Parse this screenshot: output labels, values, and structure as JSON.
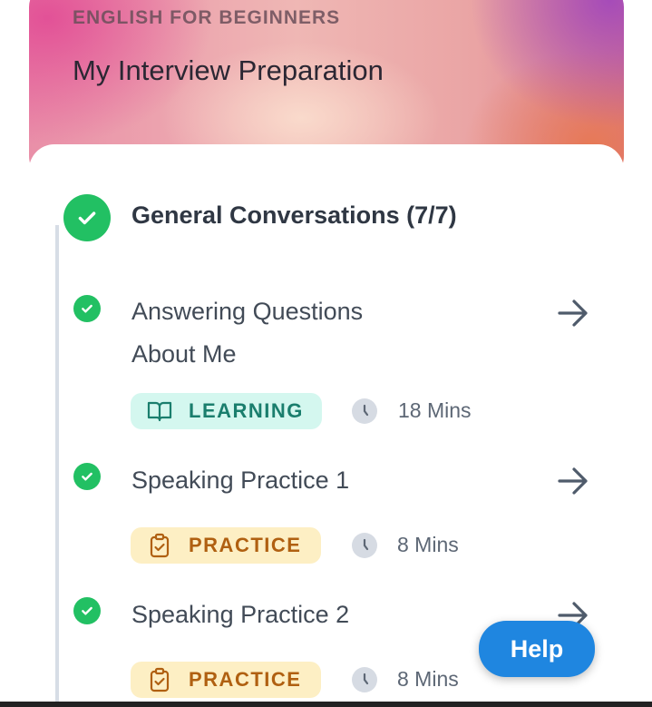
{
  "header": {
    "eyebrow": "ENGLISH FOR BEGINNERS",
    "title": "My Interview Preparation"
  },
  "section": {
    "title": "General Conversations (7/7)",
    "status": "complete"
  },
  "items": [
    {
      "title_line1": "Answering Questions",
      "title_line2": "About Me",
      "tag": "LEARNING",
      "tag_icon": "book-icon",
      "duration": "18 Mins",
      "complete": true
    },
    {
      "title_line1": "Speaking Practice 1",
      "tag": "PRACTICE",
      "tag_icon": "clipboard-check-icon",
      "duration": "8 Mins",
      "complete": true
    },
    {
      "title_line1": "Speaking Practice 2",
      "tag": "PRACTICE",
      "tag_icon": "clipboard-check-icon",
      "duration": "8 Mins",
      "complete": true
    }
  ],
  "help": {
    "label": "Help"
  },
  "colors": {
    "complete": "#22c063",
    "learning_bg": "#d4f7ef",
    "learning_fg": "#1a7e6d",
    "practice_bg": "#fdefc4",
    "practice_fg": "#b06011",
    "help_bg": "#1f86e0"
  }
}
